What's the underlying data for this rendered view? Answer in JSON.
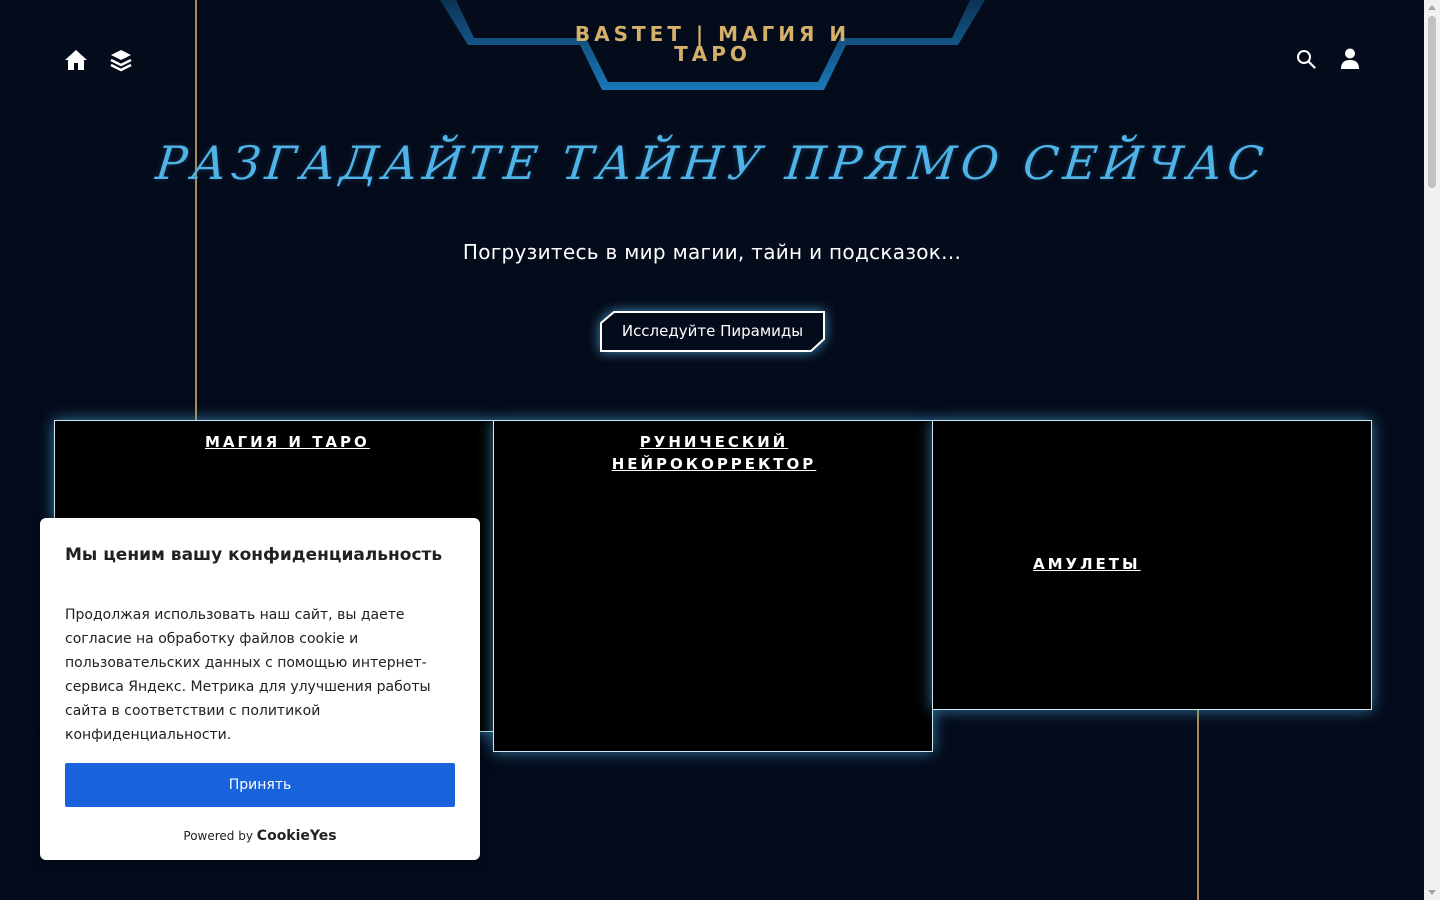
{
  "header": {
    "brand": "BASTET | МАГИЯ И ТАРО",
    "left_icons": [
      "home-icon",
      "layers-icon"
    ],
    "right_icons": [
      "search-icon",
      "user-icon"
    ]
  },
  "hero": {
    "title": "РАЗГАДАЙТЕ ТАЙНУ ПРЯМО СЕЙЧАС",
    "subtitle": "Погрузитесь в мир магии, тайн и подсказок...",
    "cta": "Исследуйте Пирамиды"
  },
  "cards": [
    {
      "title": "МАГИЯ И ТАРО"
    },
    {
      "title": "РУНИЧЕСКИЙ НЕЙРОКОРРЕКТОР"
    },
    {
      "title": "АМУЛЕТЫ"
    }
  ],
  "cookie_banner": {
    "title": "Мы ценим вашу конфиденциальность",
    "text": "Продолжая использовать наш сайт, вы даете согласие на обработку файлов cookie и пользовательских данных с помощью интернет-сервиса Яндекс. Метрика для улучшения работы сайта в соответствии с политикой конфиденциальности.",
    "accept": "Принять",
    "powered_by": "Powered by",
    "powered_logo": "CookieYes"
  },
  "colors": {
    "background": "#040b1b",
    "accent_blue": "#4fb3e8",
    "gold": "#d4b06a",
    "accept_button": "#1863dc"
  }
}
